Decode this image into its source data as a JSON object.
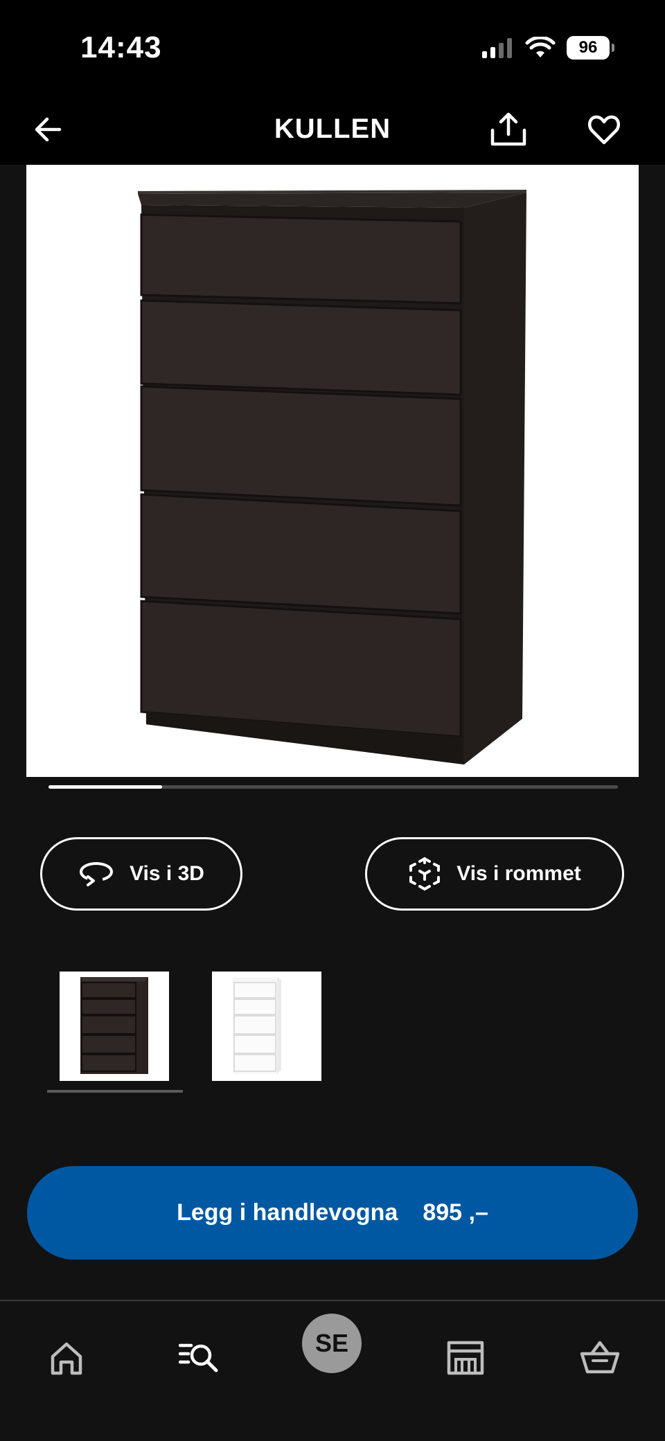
{
  "status_bar": {
    "time": "14:43",
    "battery": "96"
  },
  "header": {
    "title": "KULLEN"
  },
  "carousel": {
    "progress": 0.2
  },
  "actions": {
    "view_3d_label": "Vis i 3D",
    "view_room_label": "Vis i rommet"
  },
  "variants": {
    "items": [
      "black-brown",
      "white"
    ],
    "selected_index": 0
  },
  "cart_button": {
    "label": "Legg i handlevogna",
    "price": "895 ,–"
  },
  "tab_bar": {
    "profile_label": "SE"
  },
  "colors": {
    "brand_blue": "#0058a3",
    "background": "#121212",
    "header": "#000000"
  }
}
